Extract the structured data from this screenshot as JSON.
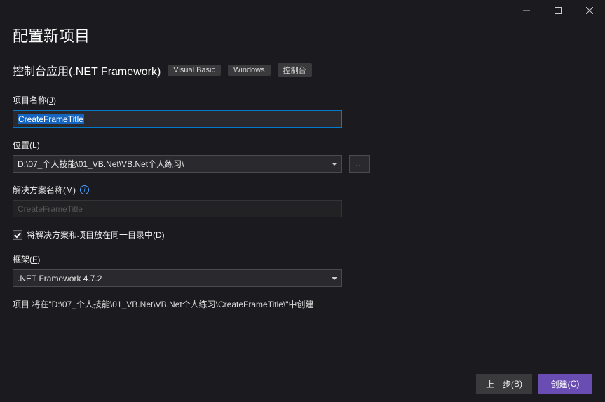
{
  "window": {
    "heading": "配置新项目",
    "subheading": "控制台应用(.NET Framework)",
    "tags": [
      "Visual Basic",
      "Windows",
      "控制台"
    ]
  },
  "fields": {
    "project_name": {
      "label_text": "项目名称(",
      "label_key": "J",
      "label_suffix": ")",
      "value": "CreateFrameTitle"
    },
    "location": {
      "label_text": "位置(",
      "label_key": "L",
      "label_suffix": ")",
      "value": "D:\\07_个人技能\\01_VB.Net\\VB.Net个人练习\\",
      "browse": "..."
    },
    "solution_name": {
      "label_text": "解决方案名称(",
      "label_key": "M",
      "label_suffix": ")",
      "placeholder": "CreateFrameTitle"
    },
    "same_dir": {
      "label_text": "将解决方案和项目放在同一目录中(",
      "label_key": "D",
      "label_suffix": ")",
      "checked": true
    },
    "framework": {
      "label_text": "框架(",
      "label_key": "F",
      "label_suffix": ")",
      "value": ".NET Framework 4.7.2"
    }
  },
  "summary": "项目 将在\"D:\\07_个人技能\\01_VB.Net\\VB.Net个人练习\\CreateFrameTitle\\\"中创建",
  "buttons": {
    "back_text": "上一步(",
    "back_key": "B",
    "back_suffix": ")",
    "create_text": "创建(",
    "create_key": "C",
    "create_suffix": ")"
  }
}
